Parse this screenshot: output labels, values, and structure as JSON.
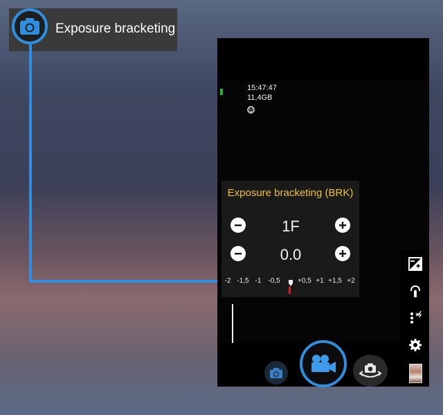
{
  "callout": {
    "title": "Exposure bracketing",
    "icon": "camera-icon",
    "accent_color": "#2f8ee0"
  },
  "status": {
    "time": "15:47:47",
    "storage": "11,4GB",
    "battery_color": "#26b526",
    "face_icon": "face-detect-icon"
  },
  "bracketing_panel": {
    "title": "Exposure bracketing (BRK)",
    "title_color": "#f1c232",
    "frames_value": "1F",
    "ev_value": "0.0",
    "scale_labels": [
      "-2",
      "-1,5",
      "-1",
      "-0,5",
      "+0,5",
      "+1",
      "+1,5",
      "+2"
    ],
    "marker_color": "#d22222"
  },
  "bottom_bar": {
    "photo_icon": "camera-icon",
    "video_icon": "video-camera-icon",
    "switch_icon": "switch-camera-icon"
  },
  "right_bar": {
    "icons": [
      "exposure-icon",
      "touch-icon",
      "flash-menu-icon",
      "settings-gear-icon",
      "gallery-thumbnail"
    ]
  }
}
